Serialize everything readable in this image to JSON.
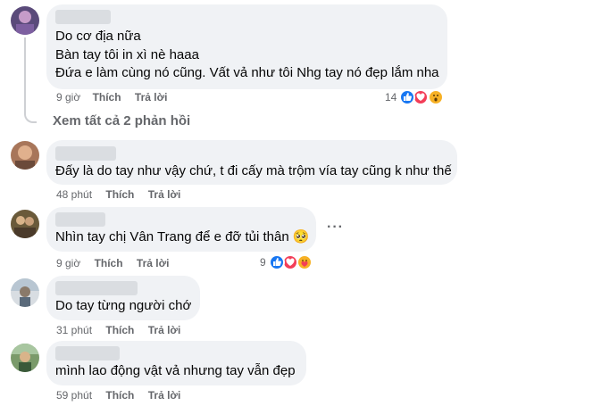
{
  "comments": [
    {
      "lines": [
        "Do cơ địa nữa",
        "Bàn tay tôi in xì nè haaa",
        "Đứa e làm cùng nó cũng. Vất vả như tôi Nhg tay nó đẹp lắm nha"
      ],
      "time": "9 giờ",
      "like": "Thích",
      "reply": "Trả lời",
      "reaction_count": "14",
      "reactions": [
        "like-icon",
        "love-icon",
        "wow-icon"
      ]
    },
    {
      "lines": [
        "Đấy là do tay như vậy chứ, t đi cấy mà trộm vía tay cũng k như thế"
      ],
      "time": "48 phút",
      "like": "Thích",
      "reply": "Trả lời"
    },
    {
      "lines": [
        "Nhìn tay chị Vân Trang để e đỡ tủi thân 🥺"
      ],
      "time": "9 giờ",
      "like": "Thích",
      "reply": "Trả lời",
      "reaction_count": "9",
      "reactions": [
        "like-icon",
        "love-icon",
        "care-icon"
      ]
    },
    {
      "lines": [
        "Do tay từng người chớ"
      ],
      "time": "31 phút",
      "like": "Thích",
      "reply": "Trả lời"
    },
    {
      "lines": [
        "mình lao động vật vả nhưng tay vẫn đẹp"
      ],
      "time": "59 phút",
      "like": "Thích",
      "reply": "Trả lời"
    }
  ],
  "see_all_replies": "Xem tất cả 2 phản hồi",
  "more_options": "···",
  "colors": {
    "like": "#1877f2",
    "love": "#f33e58",
    "wow": "#f7b125",
    "bubble": "#f0f2f5",
    "meta": "#65676b"
  }
}
